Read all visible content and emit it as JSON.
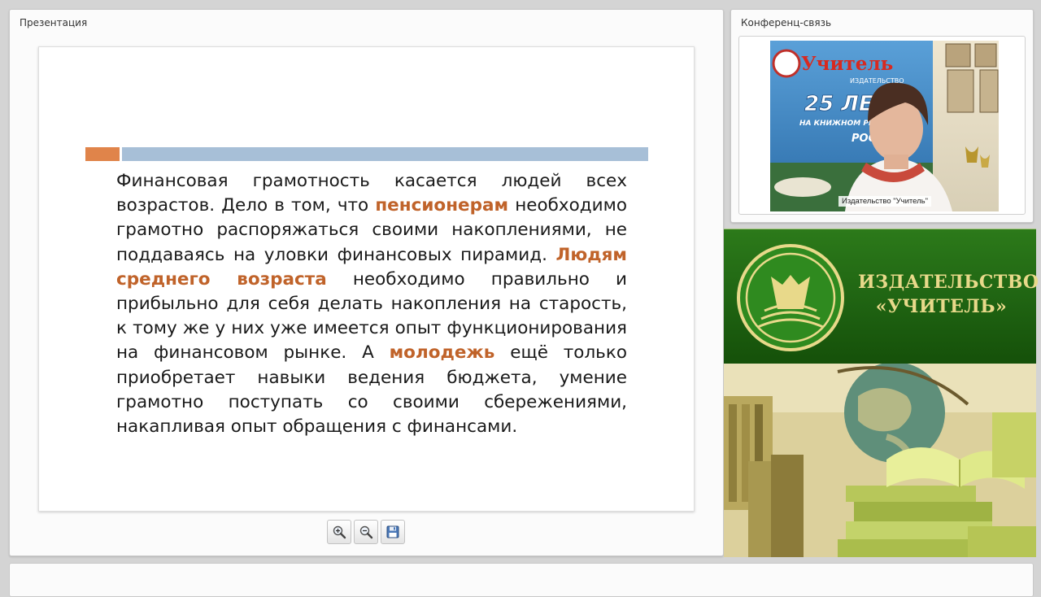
{
  "presentation": {
    "title": "Презентация",
    "slide": {
      "paragraph": [
        {
          "text": "Финансовая грамотность касается людей всех возрастов. Дело в том, что ",
          "highlight": false
        },
        {
          "text": "пенсионерам",
          "highlight": true
        },
        {
          "text": " необходимо грамотно распоряжаться своими накоплениями, не поддаваясь на уловки финансовых пирамид. ",
          "highlight": false
        },
        {
          "text": "Людям среднего возраста",
          "highlight": true
        },
        {
          "text": " необходимо правильно и прибыльно для себя делать накопления на старость, к тому же у них уже имеется опыт функционирования на финансовом рынке. А ",
          "highlight": false
        },
        {
          "text": "молодежь",
          "highlight": true
        },
        {
          "text": " ещё только приобретает навыки ведения бюджета, умение грамотно поступать со своими сбережениями, накапливая опыт обращения с финансами.",
          "highlight": false
        }
      ]
    },
    "toolbar": {
      "buttons": [
        {
          "name": "zoom-in-button",
          "icon": "zoom-in-icon"
        },
        {
          "name": "zoom-out-button",
          "icon": "zoom-out-icon"
        },
        {
          "name": "save-button",
          "icon": "floppy-disk-icon"
        }
      ]
    }
  },
  "conference": {
    "title": "Конференц-связь",
    "speaker_label": "Издательство \"Учитель\"",
    "banner": {
      "brand": "Учитель",
      "sub": "ИЗДАТЕЛЬСТВО",
      "anniversary": "25 ЛЕТ",
      "line": "НА КНИЖНОМ РЫНКЕ",
      "country": "РОССИИ"
    }
  },
  "publisher": {
    "line1": "ИЗДАТЕЛЬСТВО",
    "line2": "«УЧИТЕЛЬ»"
  },
  "colors": {
    "accent_orange": "#e0844a",
    "accent_blue": "#a7bfd7",
    "highlight_text": "#c0632a",
    "brand_green": "#1f6312",
    "brand_gold": "#e8d98a"
  }
}
